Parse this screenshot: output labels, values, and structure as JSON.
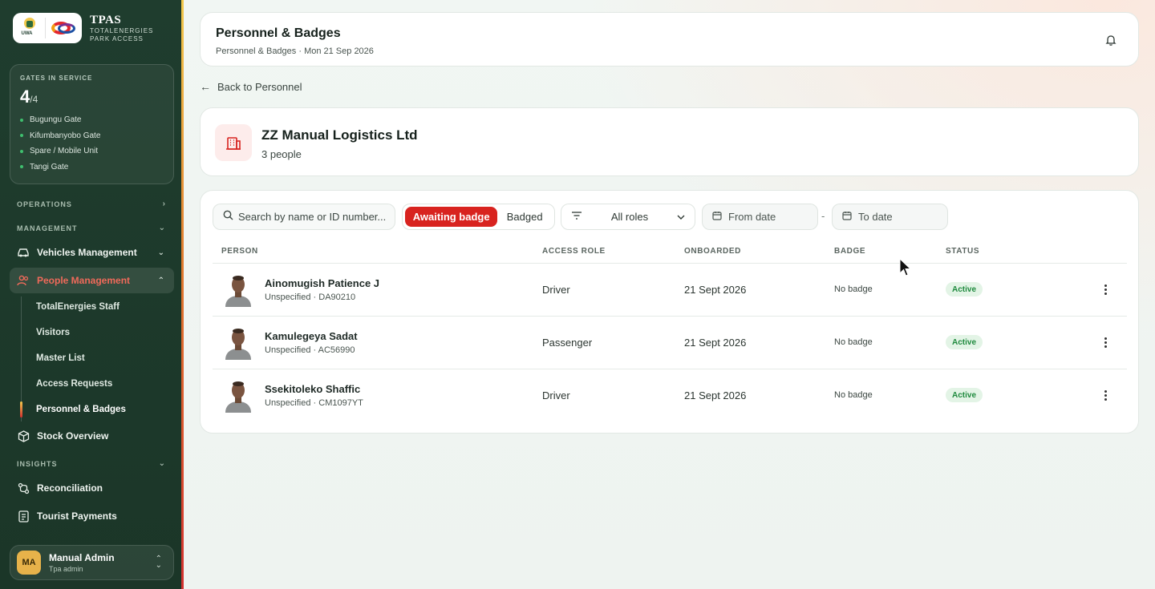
{
  "brand": {
    "title": "TPAS",
    "subtitle_line1": "TOTALENERGIES",
    "subtitle_line2": "PARK ACCESS",
    "uwa_label": "UWA"
  },
  "gates": {
    "label": "GATES IN SERVICE",
    "count": "4",
    "total": "/4",
    "items": [
      "Bugungu Gate",
      "Kifumbanyobo Gate",
      "Spare / Mobile Unit",
      "Tangi Gate"
    ],
    "status_color": "#3fbf6e"
  },
  "nav": {
    "operations": "OPERATIONS",
    "management": "MANAGEMENT",
    "insights": "INSIGHTS",
    "vehicles": "Vehicles Management",
    "people": "People Management",
    "sub": [
      "TotalEnergies Staff",
      "Visitors",
      "Master List",
      "Access Requests",
      "Personnel & Badges"
    ],
    "stock": "Stock Overview",
    "reconciliation": "Reconciliation",
    "tourist_payments": "Tourist Payments"
  },
  "user": {
    "initials": "MA",
    "name": "Manual Admin",
    "role": "Tpa admin"
  },
  "header": {
    "title": "Personnel & Badges",
    "crumb": "Personnel & Badges · Mon 21 Sep 2026"
  },
  "back_label": "Back to Personnel",
  "company": {
    "name": "ZZ Manual Logistics Ltd",
    "count": "3 people"
  },
  "filters": {
    "search_placeholder": "Search by name or ID number...",
    "awaiting": "Awaiting badge",
    "badged": "Badged",
    "role": "All roles",
    "from": "From date",
    "to": "To date",
    "sep": "-"
  },
  "columns": {
    "person": "PERSON",
    "role": "ACCESS ROLE",
    "onboarded": "ONBOARDED",
    "badge": "BADGE",
    "status": "STATUS"
  },
  "rows": [
    {
      "name": "Ainomugish Patience J",
      "sub": "Unspecified · DA90210",
      "role": "Driver",
      "onboarded": "21 Sept 2026",
      "badge": "No badge",
      "status": "Active"
    },
    {
      "name": "Kamulegeya Sadat",
      "sub": "Unspecified · AC56990",
      "role": "Passenger",
      "onboarded": "21 Sept 2026",
      "badge": "No badge",
      "status": "Active"
    },
    {
      "name": "Ssekitoleko Shaffic",
      "sub": "Unspecified · CM1097YT",
      "role": "Driver",
      "onboarded": "21 Sept 2026",
      "badge": "No badge",
      "status": "Active"
    }
  ],
  "colors": {
    "sidebar": "#1f3d2e",
    "accent_red": "#d8231f",
    "active_nav": "#f06a5a",
    "status_green": "#1f8a3e"
  }
}
